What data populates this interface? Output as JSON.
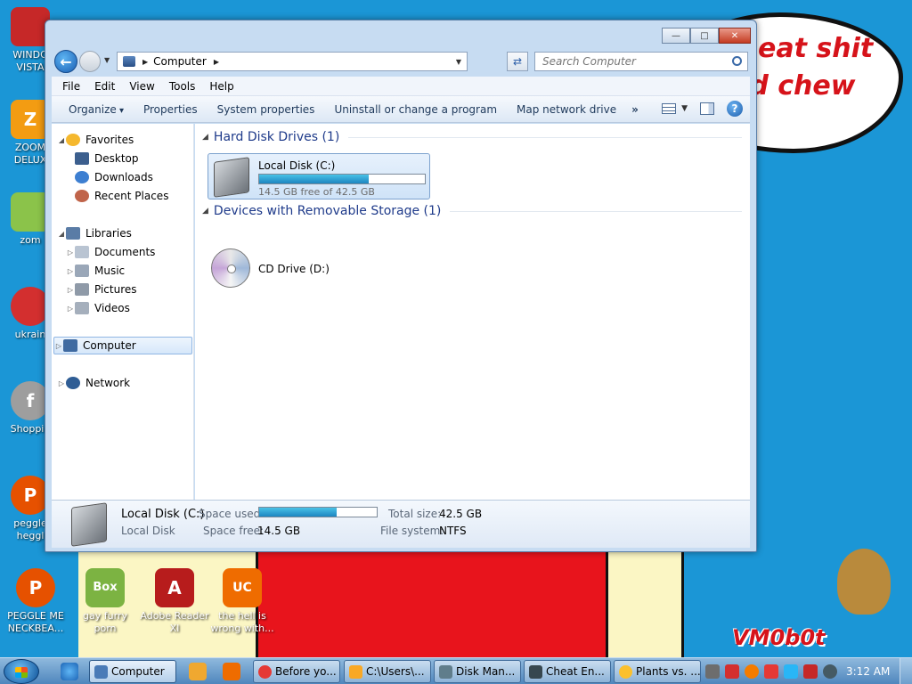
{
  "desktop": {
    "speech_text": "o eat shit\nnd chew\nm",
    "corner_text": "VM0b0t",
    "icons": [
      {
        "label": "WINDO\nVISTA",
        "color": "#c62828",
        "glyph": ""
      },
      {
        "label": "ZOOM\nDELUX",
        "color": "#f39c12",
        "glyph": "Z"
      },
      {
        "label": "zom",
        "color": "#8bc34a",
        "glyph": ""
      },
      {
        "label": "ukrain",
        "color": "#d32f2f",
        "glyph": ""
      },
      {
        "label": "Shoppin",
        "color": "#9e9e9e",
        "glyph": "f"
      },
      {
        "label": "peggle\nheggl",
        "color": "#e65100",
        "glyph": "P"
      },
      {
        "label": "PEGGLE ME\nNECKBEA...",
        "color": "#e65100",
        "glyph": "P"
      },
      {
        "label": "gay furry\nporn",
        "color": "#7cb342",
        "glyph": "Box"
      },
      {
        "label": "Adobe Reader\nXI",
        "color": "#b71c1c",
        "glyph": "A"
      },
      {
        "label": "the hell is\nwrong with...",
        "color": "#ef6c00",
        "glyph": "UC"
      }
    ]
  },
  "window": {
    "address": {
      "location": "Computer"
    },
    "search": {
      "placeholder": "Search Computer"
    },
    "menu": [
      "File",
      "Edit",
      "View",
      "Tools",
      "Help"
    ],
    "toolbar": {
      "organize": "Organize",
      "items": [
        "Properties",
        "System properties",
        "Uninstall or change a program",
        "Map network drive"
      ],
      "more": "»"
    },
    "nav": {
      "favorites": "Favorites",
      "desktop": "Desktop",
      "downloads": "Downloads",
      "recent": "Recent Places",
      "libraries": "Libraries",
      "documents": "Documents",
      "music": "Music",
      "pictures": "Pictures",
      "videos": "Videos",
      "computer": "Computer",
      "network": "Network"
    },
    "groups": {
      "hdd": "Hard Disk Drives (1)",
      "removable": "Devices with Removable Storage (1)"
    },
    "drive_c": {
      "name": "Local Disk (C:)",
      "free_text": "14.5 GB free of 42.5 GB",
      "used_fraction": 0.66
    },
    "drive_d": {
      "name": "CD Drive (D:)"
    },
    "details": {
      "name": "Local Disk (C:)",
      "type": "Local Disk",
      "space_used_label": "Space used:",
      "space_free_label": "Space free:",
      "space_free": "14.5 GB",
      "total_size_label": "Total size:",
      "total_size": "42.5 GB",
      "fs_label": "File system:",
      "fs": "NTFS",
      "used_fraction": 0.66
    }
  },
  "taskbar": {
    "buttons": [
      {
        "label": "Computer",
        "color": "#4a7bb7"
      },
      {
        "label": "Before yo...",
        "color": "#e53935"
      },
      {
        "label": "C:\\Users\\...",
        "color": "#f9a825"
      },
      {
        "label": "Disk Man...",
        "color": "#607d8b"
      },
      {
        "label": "Cheat En...",
        "color": "#37474f"
      },
      {
        "label": "Plants vs. ...",
        "color": "#fbc02d"
      }
    ],
    "clock": "3:12 AM"
  }
}
